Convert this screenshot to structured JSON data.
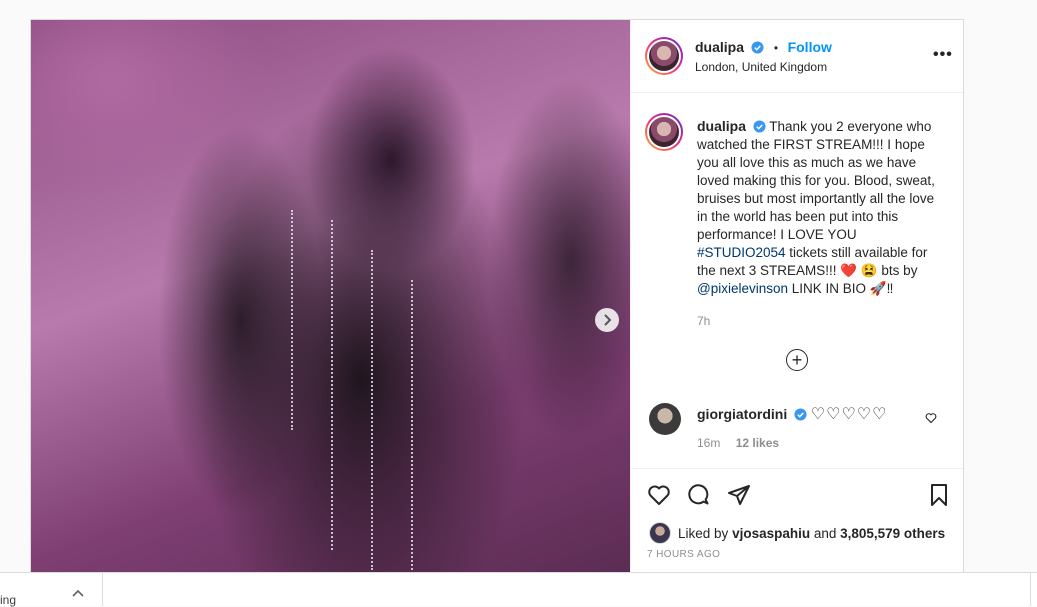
{
  "post": {
    "author": "dualipa",
    "follow_label": "Follow",
    "location": "London, United Kingdom",
    "more_label": "•••",
    "caption_parts": {
      "p1": "Thank you 2 everyone who watched the FIRST STREAM!!! I hope you all love this as much as we have loved making this for you. Blood, sweat, bruises but most importantly all the love in the world has been put into this performance! I LOVE YOU ",
      "hashtag": "#STUDIO2054",
      "p2": " tickets still available for the next 3 STREAMS!!! ❤️ 😫 bts by ",
      "mention": "@pixielevinson",
      "p3": " LINK IN BIO 🚀‼"
    },
    "caption_time": "7h",
    "comment": {
      "user": "giorgiatordini",
      "text": "♡♡♡♡♡",
      "time": "16m",
      "likes": "12 likes"
    },
    "liked_by": {
      "prefix": "Liked by ",
      "user": "vjosaspahiu",
      "middle": " and ",
      "count": "3,805,579 others"
    },
    "time_ago": "7 HOURS AGO"
  },
  "download_bar": {
    "file_name": "ing"
  },
  "colors": {
    "accent": "#0095f6",
    "verified": "#3897f0",
    "link": "#00376b"
  }
}
